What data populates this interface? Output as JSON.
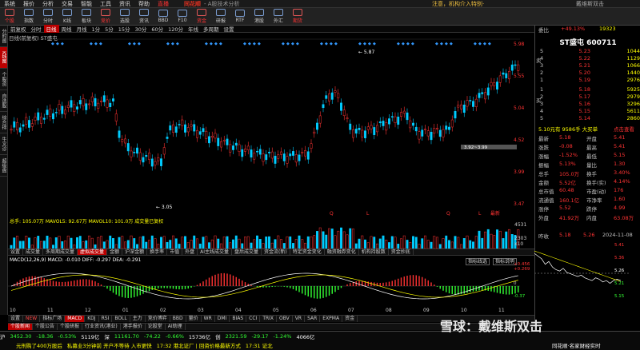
{
  "menubar": {
    "items": [
      "系统",
      "报价",
      "分析",
      "交易",
      "智能",
      "工具",
      "资讯",
      "帮助"
    ],
    "live": "直播",
    "brand": "同花顺",
    "subtitle": "- A股技术分析",
    "notice": "注意，机构介入特别·",
    "ctl": "戴维斯双击"
  },
  "toolbar": {
    "items": [
      "个股",
      "指数",
      "分时",
      "K线",
      "板块",
      "竞价",
      "选股",
      "资讯",
      "BBD",
      "F10",
      "资金",
      "研报",
      "RTF",
      "港股",
      "外汇",
      "期货"
    ]
  },
  "leftstrip": [
    "分时图",
    "K线图",
    "个股资料",
    "自选股",
    "综合排名",
    "牛叉诊股",
    "超级盘口"
  ],
  "cycle": {
    "items": [
      "前复权",
      "分时",
      "日线",
      "周线",
      "月线",
      "1分",
      "5分",
      "15分",
      "30分",
      "60分",
      "120分",
      "年线",
      "多周期",
      "设置"
    ],
    "active": 2
  },
  "chart_head": "日线(前复权)  ST盛屯",
  "kline": {
    "ylabels": [
      "5.98",
      "5.55",
      "5.04",
      "4.52",
      "3.99",
      "3.47"
    ],
    "annotations": {
      "high": "5.87",
      "low": "3.05",
      "range": "3.92~3.99"
    },
    "markers": [
      "Q",
      "L",
      "Q",
      "L",
      "最新"
    ]
  },
  "volume": {
    "head": "总手: 105.07万  MAVOL5: 92.67万  MAVOL10: 101.0万  成交量已复权",
    "ylabels": [
      "4531",
      "2303",
      "x10"
    ]
  },
  "tabs1": [
    "设置",
    "成交量",
    "多周期成交量",
    "虚拟成交量",
    "金额",
    "沪深金额",
    "换手率",
    "市值",
    "外盘",
    "AI主线成交量",
    "盘后成交量",
    "资金流(新)",
    "特定资金变化",
    "融资融券变化",
    "机构持股数",
    "资金抄底"
  ],
  "tabs1_active": 3,
  "macd": {
    "head": "MACD(12,26,9)  MACD: -0.010  DIFF: -0.297  DEA: -0.291",
    "btns": [
      "指标线选",
      "指标说明"
    ],
    "ylabels": [
      "+0.456",
      "+0.269",
      "0",
      "-0.37"
    ]
  },
  "dates": [
    "10",
    "11",
    "12",
    "01",
    "02",
    "03",
    "04",
    "05",
    "06",
    "07",
    "08",
    "09",
    "10",
    "11"
  ],
  "tabs2": [
    "设置",
    "NEW",
    "指标广场",
    "MACD",
    "KDJ",
    "RSI",
    "BOLL",
    "主力",
    "竞价博弈",
    "BBD",
    "量价",
    "WR",
    "DMI",
    "BIAS",
    "CCI",
    "TRIX",
    "OBV",
    "VR",
    "SAR",
    "EXPMA",
    "资金"
  ],
  "tabs2_active": 3,
  "tabs3": [
    "个股新闻",
    "个股公告",
    "个股研报",
    "行业资讯(港业)",
    "港手报价",
    "论股堂",
    "AI助理"
  ],
  "ticker": {
    "row1": [
      {
        "t": "沪",
        "c": "w"
      },
      {
        "t": "3452.30",
        "c": "g"
      },
      {
        "t": "-18.36",
        "c": "g"
      },
      {
        "t": "-0.53%",
        "c": "g"
      },
      {
        "t": "5119亿",
        "c": "w"
      },
      {
        "t": "深",
        "c": "w"
      },
      {
        "t": "11161.70",
        "c": "g"
      },
      {
        "t": "-74.22",
        "c": "g"
      },
      {
        "t": "-0.66%",
        "c": "g"
      },
      {
        "t": "15736亿",
        "c": "w"
      },
      {
        "t": "创",
        "c": "w"
      },
      {
        "t": "2321.59",
        "c": "g"
      },
      {
        "t": "-29.17",
        "c": "g"
      },
      {
        "t": "-1.24%",
        "c": "g"
      },
      {
        "t": "4066亿",
        "c": "w"
      }
    ],
    "row2": [
      {
        "t": "元刑购了400万股后",
        "c": "y"
      },
      {
        "t": "私募业3分钟前 开户不等待 入市更快",
        "c": "y"
      },
      {
        "t": "17:32 港北证厂 | 回资价格最新方式",
        "c": "y"
      },
      {
        "t": "17:31 证北",
        "c": "y"
      }
    ],
    "right": "同花顺·名家财经实时"
  },
  "panel": {
    "title": "ST盛屯 600711",
    "weibi": "委比",
    "weibi_val": "+49.13%",
    "weicha": "19323",
    "asks": [
      {
        "l": "5",
        "p": "5.23",
        "v": "1044"
      },
      {
        "l": "4",
        "p": "5.22",
        "v": "1129"
      },
      {
        "l": "3",
        "p": "5.21",
        "v": "1066"
      },
      {
        "l": "2",
        "p": "5.20",
        "v": "1440"
      },
      {
        "l": "1",
        "p": "5.19",
        "v": "2976"
      }
    ],
    "bids": [
      {
        "l": "1",
        "p": "5.18",
        "v": "5925"
      },
      {
        "l": "2",
        "p": "5.17",
        "v": "2979"
      },
      {
        "l": "3",
        "p": "5.16",
        "v": "3296"
      },
      {
        "l": "4",
        "p": "5.15",
        "v": "5611"
      },
      {
        "l": "5",
        "p": "5.14",
        "v": "2860"
      }
    ],
    "ask_label": "卖",
    "bid_label": "买",
    "summary": "5.10元有 9586手 大买单",
    "summary_link": "点击查看",
    "stats": [
      [
        "最新",
        "5.18",
        "开盘",
        "5.41"
      ],
      [
        "涨跌",
        "-0.08",
        "最高",
        "5.41"
      ],
      [
        "涨幅",
        "-1.52%",
        "最低",
        "5.15"
      ],
      [
        "振幅",
        "5.13%",
        "量比",
        "1.30"
      ],
      [
        "总手",
        "105.0万",
        "换手",
        "3.40%"
      ],
      [
        "金额",
        "5.52亿",
        "换手(实)",
        "4.14%"
      ],
      [
        "总市值",
        "60.48",
        "市盈(动)",
        "176"
      ],
      [
        "流通值",
        "160.1亿",
        "市净率",
        "1.60"
      ],
      [
        "涨停",
        "5.52",
        "跌停",
        "4.99"
      ],
      [
        "外盘",
        "41.92万",
        "内盘",
        "63.08万"
      ]
    ],
    "intraday_head": {
      "prev": "昨收",
      "price": "5.18",
      "hi": "5.26",
      "date": "2024-11-08"
    },
    "intraday_y": [
      "5.41",
      "5.36",
      "5.26",
      "5.21",
      "5.15"
    ],
    "intraday_values": [
      5.38,
      5.36,
      5.34,
      5.3,
      5.32,
      5.28,
      5.26,
      5.25,
      5.27,
      5.24,
      5.23,
      5.22,
      5.21,
      5.22,
      5.2,
      5.19,
      5.18,
      5.2,
      5.19,
      5.17,
      5.18,
      5.16,
      5.18,
      5.19,
      5.18
    ]
  },
  "watermark": "雪球：戴维斯双击"
}
